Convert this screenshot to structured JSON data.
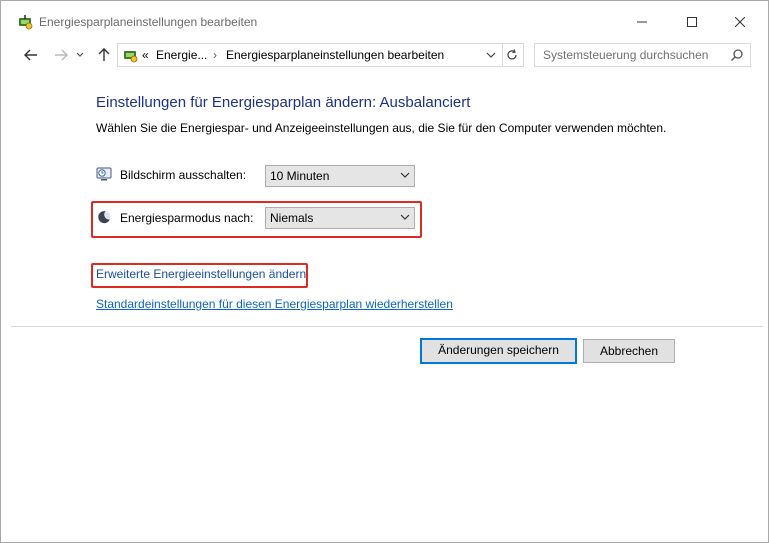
{
  "window": {
    "title": "Energiesparplaneinstellungen bearbeiten",
    "app_icon": "power-options-icon"
  },
  "navigation": {
    "back_icon": "arrow-left-icon",
    "forward_icon": "arrow-right-icon",
    "recent_icon": "chevron-down-icon",
    "up_icon": "arrow-up-icon"
  },
  "address": {
    "overflow": "«",
    "segments": [
      "Energie...",
      "Energiesparplaneinstellungen bearbeiten"
    ],
    "separator": "›"
  },
  "search": {
    "placeholder": "Systemsteuerung durchsuchen"
  },
  "main": {
    "heading": "Einstellungen für Energiesparplan ändern: Ausbalanciert",
    "subtitle": "Wählen Sie die Energiespar- und Anzeigeeinstellungen aus, die Sie für den Computer verwenden möchten.",
    "display_off": {
      "label": "Bildschirm ausschalten:",
      "value": "10 Minuten",
      "icon": "monitor-clock-icon"
    },
    "sleep": {
      "label": "Energiesparmodus nach:",
      "value": "Niemals",
      "icon": "moon-icon"
    },
    "advanced_link": "Erweiterte Energieeinstellungen ändern",
    "restore_link": "Standardeinstellungen für diesen Energiesparplan wiederherstellen"
  },
  "buttons": {
    "save": "Änderungen speichern",
    "cancel": "Abbrechen"
  },
  "colors": {
    "heading": "#1e3287",
    "link": "#0a64c8",
    "highlight": "#e02a20",
    "primary_border": "#0078d7"
  }
}
